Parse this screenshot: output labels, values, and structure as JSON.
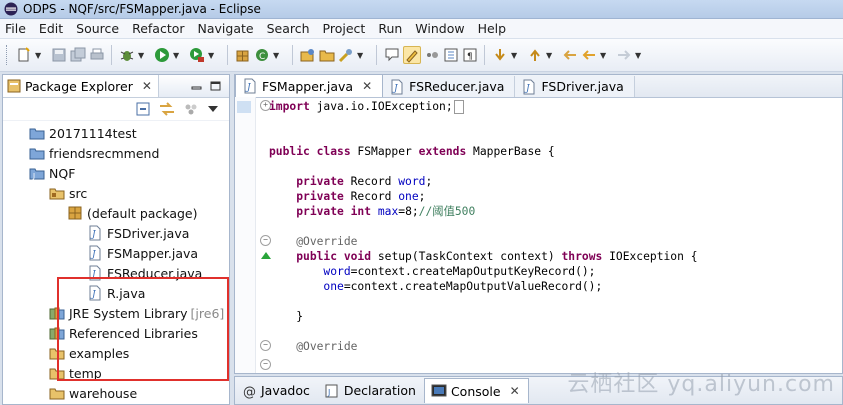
{
  "window": {
    "title": "ODPS - NQF/src/FSMapper.java - Eclipse"
  },
  "menu": [
    "File",
    "Edit",
    "Source",
    "Refactor",
    "Navigate",
    "Search",
    "Project",
    "Run",
    "Window",
    "Help"
  ],
  "explorer": {
    "tab_label": "Package Explorer",
    "tree": [
      {
        "label": "20171114test",
        "icon": "project-folder-icon",
        "level": 1
      },
      {
        "label": "friendsrecmmend",
        "icon": "project-folder-icon",
        "level": 1
      },
      {
        "label": "NQF",
        "icon": "java-project-icon",
        "level": 1
      },
      {
        "label": "src",
        "icon": "source-folder-icon",
        "level": 2
      },
      {
        "label": "(default package)",
        "icon": "package-icon",
        "level": 3
      },
      {
        "label": "FSDriver.java",
        "icon": "java-file-icon",
        "level": 4
      },
      {
        "label": "FSMapper.java",
        "icon": "java-file-icon",
        "level": 4
      },
      {
        "label": "FSReducer.java",
        "icon": "java-file-icon",
        "level": 4
      },
      {
        "label": "R.java",
        "icon": "java-file-icon",
        "level": 4
      },
      {
        "label": "JRE System Library",
        "decoration": "[jre6]",
        "icon": "library-icon",
        "level": 2
      },
      {
        "label": "Referenced Libraries",
        "icon": "library-icon",
        "level": 2
      },
      {
        "label": "examples",
        "icon": "folder-icon",
        "level": 2
      },
      {
        "label": "temp",
        "icon": "folder-icon",
        "level": 2
      },
      {
        "label": "warehouse",
        "icon": "folder-icon",
        "level": 2
      }
    ]
  },
  "editor": {
    "tabs": [
      {
        "label": "FSMapper.java",
        "active": true
      },
      {
        "label": "FSReducer.java",
        "active": false
      },
      {
        "label": "FSDriver.java",
        "active": false
      }
    ],
    "code": [
      "import java.io.IOException;",
      "",
      "",
      "public class FSMapper extends MapperBase {",
      "",
      "    private Record word;",
      "    private Record one;",
      "    private int max=8;//阈值500",
      "",
      "    @Override",
      "    public void setup(TaskContext context) throws IOException {",
      "        word=context.createMapOutputKeyRecord();",
      "        one=context.createMapOutputValueRecord();",
      "",
      "    }",
      "",
      "    @Override"
    ]
  },
  "bottom": {
    "tabs": [
      {
        "label": "Javadoc",
        "active": false
      },
      {
        "label": "Declaration",
        "active": false
      },
      {
        "label": "Console",
        "active": true
      }
    ]
  },
  "watermark": "云栖社区 yq.aliyun.com",
  "colors": {
    "keyword": "#7f0055",
    "field": "#0000c0",
    "comment": "#3f7f5f",
    "highlight_border": "#e0302c"
  }
}
